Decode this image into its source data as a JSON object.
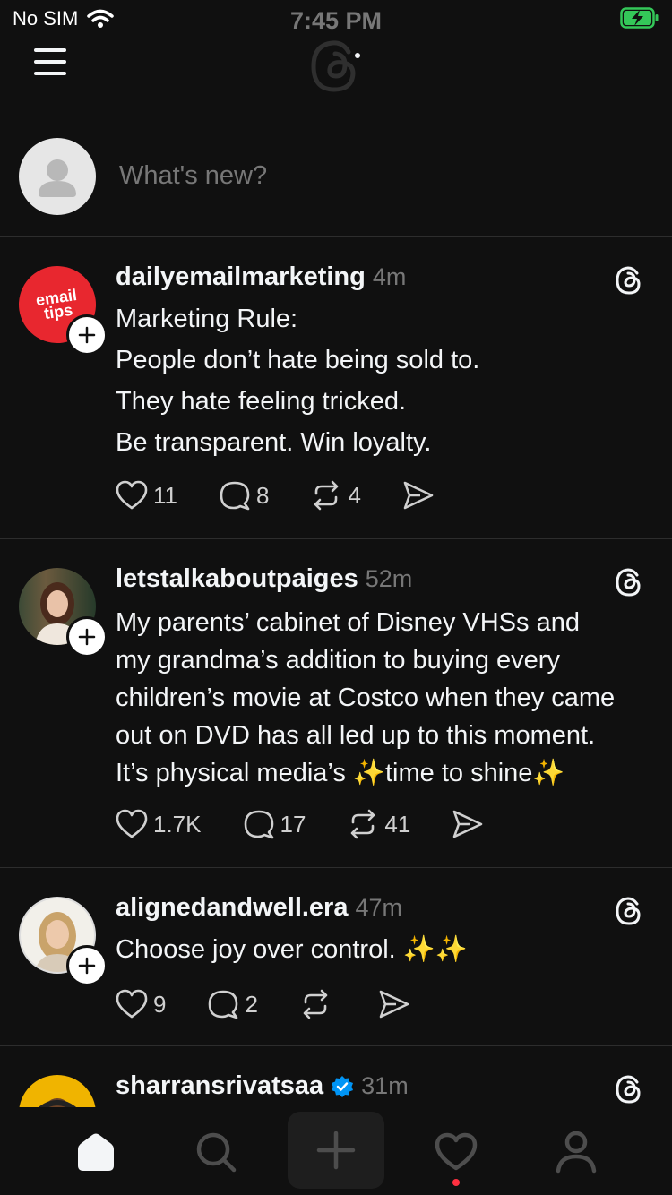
{
  "status_bar": {
    "carrier": "No SIM",
    "time": "7:45 PM"
  },
  "composer": {
    "placeholder": "What's new?"
  },
  "posts": [
    {
      "username": "dailyemailmarketing",
      "time": "4m",
      "avatar_text": [
        "email",
        "tips"
      ],
      "lines": [
        "Marketing Rule:",
        "People don’t hate being sold to.",
        "They hate feeling tricked.",
        "Be transparent. Win loyalty."
      ],
      "likes": "11",
      "replies": "8",
      "reposts": "4"
    },
    {
      "username": "letstalkaboutpaiges",
      "time": "52m",
      "lines": [
        "My parents’ cabinet of Disney VHSs and",
        "my grandma’s addition to buying every",
        "children’s movie at Costco when they came",
        "out on DVD has all led up to this moment.",
        "It’s physical media’s ✨time to shine✨"
      ],
      "likes": "1.7K",
      "replies": "17",
      "reposts": "41"
    },
    {
      "username": "alignedandwell.era",
      "time": "47m",
      "lines": [
        "Choose joy over control. ✨✨"
      ],
      "likes": "9",
      "replies": "2",
      "reposts": ""
    },
    {
      "username": "sharransrivatsaa",
      "time": "31m",
      "verified": true
    }
  ],
  "colors": {
    "background": "#101010",
    "text": "#f3f5f7",
    "muted": "#777777",
    "avatar1": "#e8272f",
    "verified": "#0095f6",
    "notification": "#ff3040"
  },
  "icons": [
    "menu-icon",
    "threads-logo",
    "wifi-icon",
    "battery-charging-icon",
    "heart-icon",
    "reply-icon",
    "repost-icon",
    "share-icon",
    "home-icon",
    "search-icon",
    "plus-icon",
    "activity-icon",
    "profile-icon"
  ]
}
